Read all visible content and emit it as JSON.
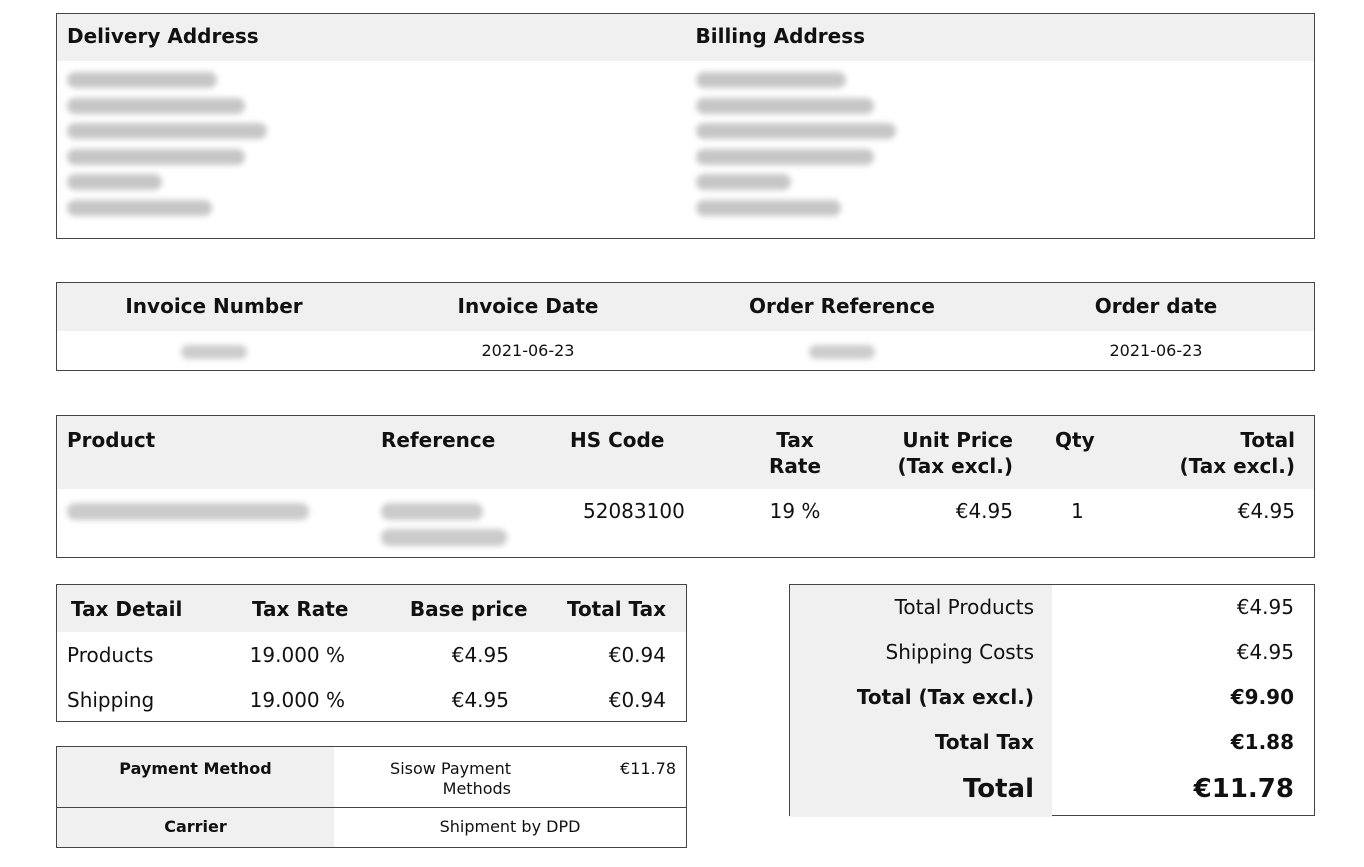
{
  "address": {
    "delivery_label": "Delivery Address",
    "billing_label": "Billing Address"
  },
  "invoice": {
    "headers": [
      "Invoice Number",
      "Invoice Date",
      "Order Reference",
      "Order date"
    ],
    "invoice_date": "2021-06-23",
    "order_date": "2021-06-23"
  },
  "products": {
    "headers": {
      "product": "Product",
      "reference": "Reference",
      "hs_code": "HS Code",
      "tax_rate_1": "Tax",
      "tax_rate_2": "Rate",
      "unit_price_1": "Unit Price",
      "unit_price_2": "(Tax excl.)",
      "qty": "Qty",
      "total_1": "Total",
      "total_2": "(Tax excl.)"
    },
    "rows": [
      {
        "hs_code": "52083100",
        "tax_rate": "19 %",
        "unit_price": "€4.95",
        "qty": "1",
        "total": "€4.95"
      }
    ]
  },
  "tax_detail": {
    "headers": [
      "Tax Detail",
      "Tax Rate",
      "Base price",
      "Total Tax"
    ],
    "rows": [
      {
        "label": "Products",
        "rate": "19.000 %",
        "base": "€4.95",
        "tax": "€0.94"
      },
      {
        "label": "Shipping",
        "rate": "19.000 %",
        "base": "€4.95",
        "tax": "€0.94"
      }
    ]
  },
  "payment": {
    "method_label": "Payment Method",
    "method_line1": "Sisow Payment",
    "method_line2": "Methods",
    "amount": "€11.78",
    "carrier_label": "Carrier",
    "carrier_value": "Shipment by DPD"
  },
  "totals": {
    "total_products_label": "Total Products",
    "total_products": "€4.95",
    "shipping_label": "Shipping Costs",
    "shipping": "€4.95",
    "total_excl_label": "Total (Tax excl.)",
    "total_excl": "€9.90",
    "total_tax_label": "Total Tax",
    "total_tax": "€1.88",
    "total_label": "Total",
    "total": "€11.78"
  }
}
